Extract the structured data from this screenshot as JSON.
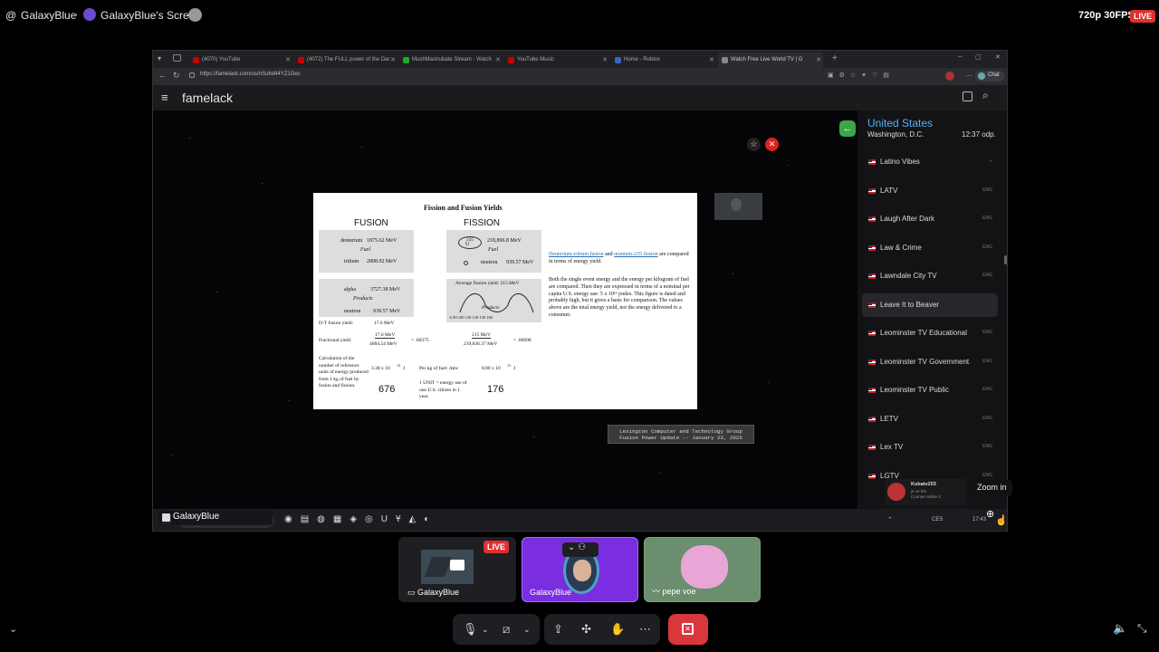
{
  "top_bar": {
    "server_name": "GalaxyBlue",
    "stream_title": "GalaxyBlue's Screen",
    "quality": "720p 30FPS",
    "live_label": "LIVE"
  },
  "browser": {
    "tabs": [
      {
        "title": "(4070) YouTube",
        "color": "#c00"
      },
      {
        "title": "(4072) The FULL power of the Dar",
        "color": "#c00"
      },
      {
        "title": "MushMastrubate Stream - Watch",
        "color": "#2a2"
      },
      {
        "title": "YouTube Music",
        "color": "#c00"
      },
      {
        "title": "Home - Roblox",
        "color": "#36c"
      },
      {
        "title": "Watch Free Live World TV | G",
        "color": "#888"
      }
    ],
    "url": "https://famelack.com/us/nSu6d44YZ1Gec",
    "chat_label": "Chat",
    "app_name": "famelack"
  },
  "slide": {
    "title": "Fission and Fusion Yields",
    "fusion_heading": "FUSION",
    "fission_heading": "FISSION",
    "deuterium": "deuterium",
    "deuterium_val": "1875.62 MeV",
    "fuel": "Fuel",
    "tritium": "tritium",
    "tritium_val": "2808.92 MeV",
    "alpha": "alpha",
    "alpha_val": "3727.38 MeV",
    "products": "Products",
    "neutron": "neutron",
    "neutron_val": "939.57 MeV",
    "u235": "235",
    "u_symbol": "U",
    "u235_val": "218,896.8 MeV",
    "fission_neutron_val": "939.57 MeV",
    "avg_yield": "Average fission yield: 215 MeV",
    "axis_ticks": "A  90  100  120  130  150  160",
    "dt_yield": "D-T fusion yield:",
    "dt_yield_val": "17.6  MeV",
    "fractional_yield": "Fractional yield:",
    "frac_fusion_num": "17.6  MeV",
    "frac_fusion_den": "4684.54  MeV",
    "frac_fusion_res": "= .00375",
    "frac_fission_num": "215  MeV",
    "frac_fission_den": "219,836.37  MeV",
    "frac_fission_res": "= .00098",
    "calc_label": "Calculation of the number of reference units of energy produced from 1 kg of fuel by fusion and fission.",
    "fusion_energy": "3.38 x 10",
    "fusion_exp": "14",
    "fusion_j": "J",
    "per_kg": "Per kg of fuel: Δmc",
    "fission_energy": "8.80 x 10",
    "fission_exp": "13",
    "fission_j": "J",
    "unit_def": "1 UNIT = energy use of one U.S. citizen in 1 year.",
    "fusion_units": "676",
    "fission_units": "176",
    "para1_link1": "Deuterium-tritium fusion",
    "para1_and": "and",
    "para1_link2": "uranium-235 fission",
    "para1_rest": "are compared in terms of energy yield.",
    "para2": "Both the single event energy and the energy per kilogram of fuel are compared. Then they are expressed in terms of a nominal per capita U.S. energy use: 5 x 10¹¹ joules. This figure is dated and probably high, but it gives a basis for comparison. The values above are the total energy yield, not the energy delivered to a consumer.",
    "caption_line1": "Lexington Computer and Technology Group",
    "caption_line2": "Fusion Power Update -- January 22, 2025"
  },
  "sidebar": {
    "country": "United States",
    "city": "Washington, D.C.",
    "time": "12:37 odp.",
    "channels": [
      {
        "name": "Latino Vibes",
        "tag": ""
      },
      {
        "name": "LATV",
        "tag": "ENG"
      },
      {
        "name": "Laugh After Dark",
        "tag": "ENG"
      },
      {
        "name": "Law & Crime",
        "tag": "ENG"
      },
      {
        "name": "Lawndale City TV",
        "tag": "ENG"
      },
      {
        "name": "Leave It to Beaver",
        "tag": ""
      },
      {
        "name": "Leominster TV Educational",
        "tag": "ENG"
      },
      {
        "name": "Leominster TV Government",
        "tag": "ENG"
      },
      {
        "name": "Leominster TV Public",
        "tag": "ENG"
      },
      {
        "name": "LETV",
        "tag": "ENG"
      },
      {
        "name": "Lex TV",
        "tag": "ENG"
      },
      {
        "name": "LGTV",
        "tag": "ENG"
      }
    ]
  },
  "notification": {
    "user": "Kubatv203",
    "line1": "je ve hře",
    "line2": "Counter-Strike 2"
  },
  "tooltip": "Zoom in",
  "taskbar": {
    "user": "GalaxyBlue",
    "lang": "CES",
    "clock": "17:43"
  },
  "participants": [
    {
      "name": "GalaxyBlue",
      "live": "LIVE"
    },
    {
      "name": "GalaxyBlue"
    },
    {
      "name": "pepe voe"
    }
  ],
  "accent": "#5865f2",
  "leave_color": "#da373c"
}
